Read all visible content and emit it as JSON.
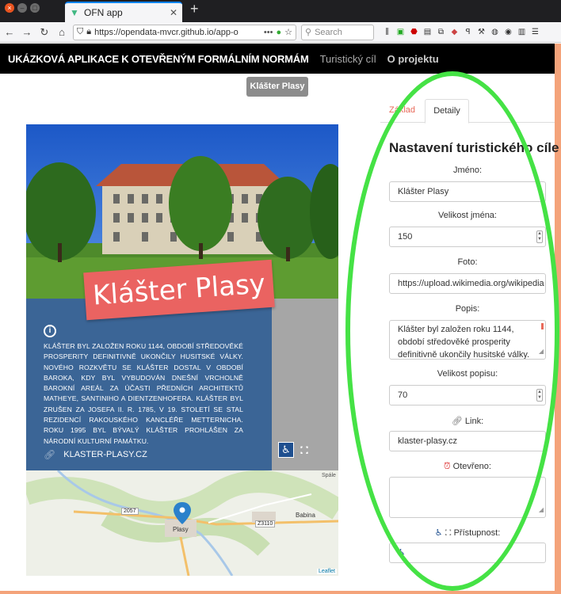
{
  "browser": {
    "tab_title": "OFN app",
    "url": "https://opendata-mvcr.github.io/app-o",
    "url_more": "•••",
    "search_placeholder": "Search"
  },
  "app": {
    "brand": "UKÁZKOVÁ APLIKACE K OTEVŘENÝM FORMÁLNÍM NORMÁM",
    "nav": [
      "Turistický cíl",
      "O projektu"
    ],
    "place_button": "Klášter Plasy"
  },
  "card": {
    "title": "Klášter Plasy",
    "description": "KLÁŠTER BYL ZALOŽEN ROKU 1144, OBDOBÍ STŘEDOVĚKÉ PROSPERITY DEFINITIVNĚ UKONČILY HUSITSKÉ VÁLKY. NOVÉHO ROZKVĚTU SE KLÁŠTER DOSTAL V OBDOBÍ BAROKA, KDY BYL VYBUDOVÁN DNEŠNÍ VRCHOLNĚ BAROKNÍ AREÁL ZA ÚČASTI PŘEDNÍCH ARCHITEKTŮ MATHEYE, SANTINIHO A DIENTZENHOFERA. KLÁŠTER BYL ZRUŠEN ZA JOSEFA II. R. 1785, V 19. STOLETÍ SE STAL REZIDENCÍ RAKOUSKÉHO KANCLÉŘE METTERNICHA. ROKU 1995 BYL BÝVALÝ KLÁŠTER PROHLÁŠEN ZA NÁRODNÍ KULTURNÍ PAMÁTKU.",
    "link": "KLASTER-PLASY.CZ",
    "map_labels": [
      "Plasy",
      "Babina",
      "2057",
      "Z3110",
      "Spále",
      "Leaflet"
    ]
  },
  "panel": {
    "tabs": [
      "Základ",
      "Detaily"
    ],
    "heading": "Nastavení turistického cíle",
    "name_label": "Jméno:",
    "name_value": "Klášter Plasy",
    "name_size_label": "Velikost jména:",
    "name_size_value": "150",
    "photo_label": "Foto:",
    "photo_value": "https://upload.wikimedia.org/wikipedia",
    "desc_label": "Popis:",
    "desc_value": "Klášter byl založen roku 1144, období středověké prosperity definitivně ukončily husitské války.",
    "desc_size_label": "Velikost popisu:",
    "desc_size_value": "70",
    "link_label": "Link:",
    "link_value": "klaster-plasy.cz",
    "open_label": "Otevřeno:",
    "open_value": "",
    "access_label": "Přístupnost:"
  },
  "colors": {
    "accent_orange": "#f4a37a",
    "banner": "#ea6361",
    "info_blue": "#3b6596",
    "highlight_green": "#45e245"
  }
}
